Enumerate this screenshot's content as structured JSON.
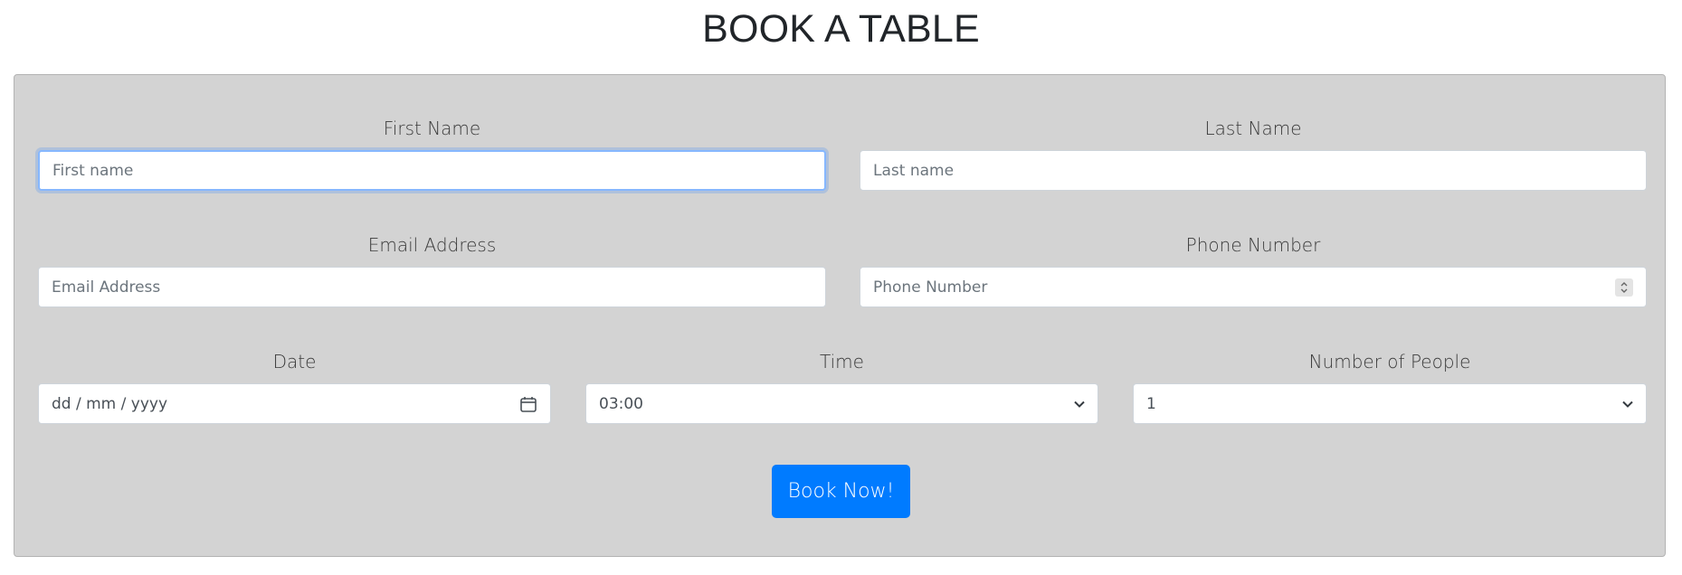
{
  "page": {
    "title": "BOOK A TABLE"
  },
  "colors": {
    "panel_background": "#d3d3d3",
    "button_background": "#007bff",
    "button_text": "#ffffff",
    "focus_ring": "#86b7fe"
  },
  "form": {
    "first_name": {
      "label": "First Name",
      "placeholder": "First name",
      "value": ""
    },
    "last_name": {
      "label": "Last Name",
      "placeholder": "Last name",
      "value": ""
    },
    "email": {
      "label": "Email Address",
      "placeholder": "Email Address",
      "value": ""
    },
    "phone": {
      "label": "Phone Number",
      "placeholder": "Phone Number",
      "value": ""
    },
    "date": {
      "label": "Date",
      "placeholder": "dd / mm / yyyy"
    },
    "time": {
      "label": "Time",
      "selected": "03:00"
    },
    "people": {
      "label": "Number of People",
      "selected": "1"
    },
    "submit_label": "Book Now!"
  },
  "icons": {
    "date": "calendar-icon",
    "time": "chevron-down-icon",
    "people": "chevron-down-icon",
    "phone": "spinner-icon"
  }
}
